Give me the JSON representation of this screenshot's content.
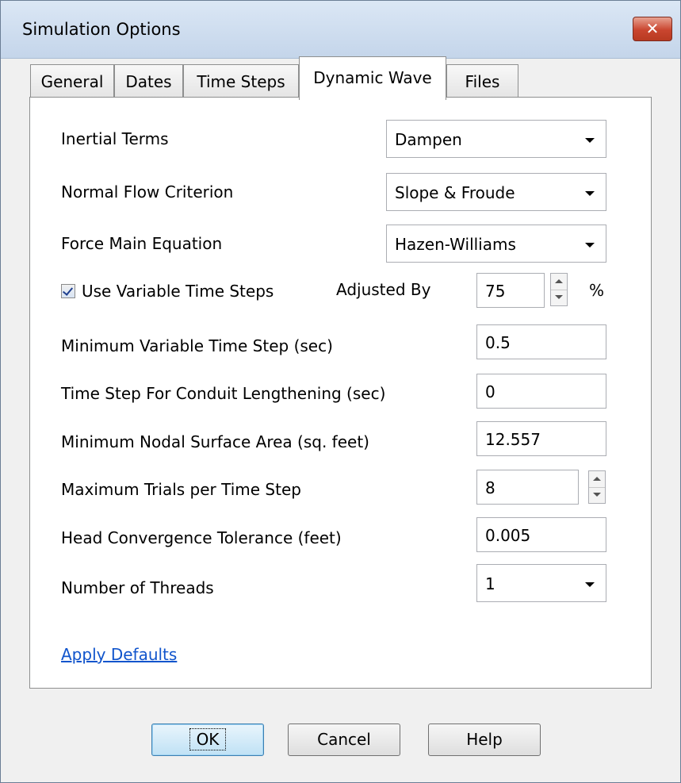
{
  "window": {
    "title": "Simulation Options",
    "close_glyph": "✕"
  },
  "tabs": [
    {
      "label": "General",
      "active": false
    },
    {
      "label": "Dates",
      "active": false
    },
    {
      "label": "Time Steps",
      "active": false
    },
    {
      "label": "Dynamic Wave",
      "active": true
    },
    {
      "label": "Files",
      "active": false
    }
  ],
  "form": {
    "inertial_terms": {
      "label": "Inertial Terms",
      "value": "Dampen"
    },
    "normal_flow": {
      "label": "Normal Flow Criterion",
      "value": "Slope & Froude"
    },
    "force_main": {
      "label": "Force Main Equation",
      "value": "Hazen-Williams"
    },
    "variable_steps": {
      "label": "Use Variable Time Steps",
      "checked": true,
      "adjusted_label": "Adjusted By",
      "value": "75",
      "unit": "%"
    },
    "min_var_step": {
      "label": "Minimum Variable Time Step (sec)",
      "value": "0.5"
    },
    "lengthening": {
      "label": "Time Step For Conduit Lengthening (sec)",
      "value": "0"
    },
    "min_surface": {
      "label": "Minimum Nodal Surface Area (sq. feet)",
      "value": "12.557"
    },
    "max_trials": {
      "label": "Maximum Trials per Time Step",
      "value": "8"
    },
    "head_tol": {
      "label": "Head Convergence Tolerance (feet)",
      "value": "0.005"
    },
    "threads": {
      "label": "Number of Threads",
      "value": "1"
    }
  },
  "apply_defaults": "Apply Defaults",
  "buttons": {
    "ok": "OK",
    "cancel": "Cancel",
    "help": "Help"
  }
}
